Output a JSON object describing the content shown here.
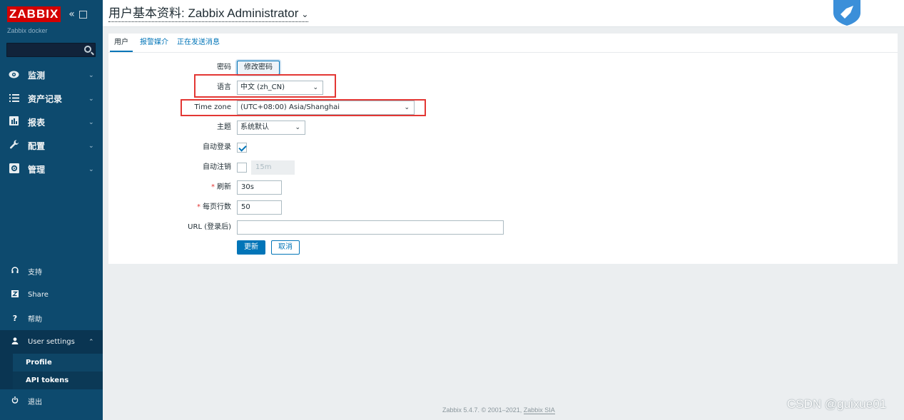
{
  "sidebar": {
    "logo": "ZABBIX",
    "server_name": "Zabbix docker",
    "search_placeholder": "",
    "menu": [
      {
        "label": "监测",
        "icon": "eye-icon"
      },
      {
        "label": "资产记录",
        "icon": "list-icon"
      },
      {
        "label": "报表",
        "icon": "bar-chart-icon"
      },
      {
        "label": "配置",
        "icon": "wrench-icon"
      },
      {
        "label": "管理",
        "icon": "gear-box-icon"
      }
    ],
    "bottom": {
      "support": "支持",
      "share": "Share",
      "help": "帮助",
      "user_settings": "User settings",
      "profile": "Profile",
      "api_tokens": "API tokens",
      "logout": "退出"
    }
  },
  "header": {
    "title": "用户基本资料: Zabbix Administrator"
  },
  "tabs": [
    "用户",
    "报警媒介",
    "正在发送消息"
  ],
  "form": {
    "password_label": "密码",
    "password_button": "修改密码",
    "language_label": "语言",
    "language_value": "中文 (zh_CN)",
    "timezone_label": "Time zone",
    "timezone_value": "(UTC+08:00) Asia/Shanghai",
    "theme_label": "主题",
    "theme_value": "系统默认",
    "autologin_label": "自动登录",
    "autologin_checked": true,
    "autologout_label": "自动注销",
    "autologout_checked": false,
    "autologout_value": "15m",
    "refresh_label": "刷新",
    "refresh_value": "30s",
    "rows_label": "每页行数",
    "rows_value": "50",
    "url_label": "URL (登录后)",
    "url_value": "",
    "update_button": "更新",
    "cancel_button": "取消"
  },
  "footer": {
    "text": "Zabbix 5.4.7. © 2001–2021, ",
    "link": "Zabbix SIA"
  },
  "watermark": "CSDN @guixue01",
  "colors": {
    "sidebar": "#0d4a6e",
    "accent": "#0275b8",
    "highlight": "#e33734",
    "logo": "#d40000"
  }
}
